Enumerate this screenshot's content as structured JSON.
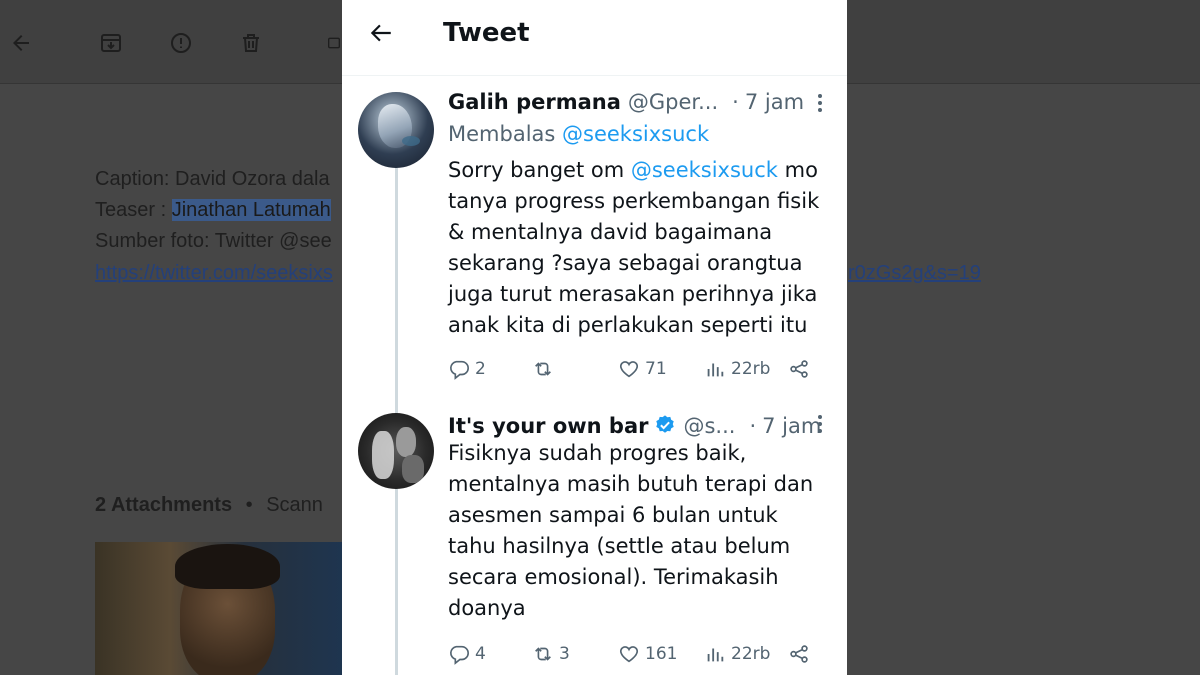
{
  "background": {
    "caption_line": "Caption: David Ozora dala",
    "teaser_label": "Teaser : ",
    "teaser_highlight": "Jinathan Latumah",
    "source_line": "Sumber foto: Twitter @see",
    "link_left": "https://twitter.com/seeksixs",
    "link_right": "r0zGs2g&s=19",
    "attachments_label": "2 Attachments",
    "attachments_sep": "•",
    "attachments_action": "Scann"
  },
  "header": {
    "title": "Tweet"
  },
  "tweets": [
    {
      "name": "Galih permana",
      "handle": "@Gper...",
      "sep": "·",
      "time": "7 jam",
      "reply_prefix": "Membalas",
      "reply_mention": "@seeksixsuck",
      "body_line1_pre": "Sorry banget om",
      "body_line1_mention": "@seeksixsuck",
      "body_line1_post": "mo",
      "body_lines": [
        "tanya progress  perkembangan fisik",
        "& mentalnya david  bagaimana",
        "sekarang ?saya sebagai orangtua",
        "juga turut merasakan perihnya jika",
        "anak kita di perlakukan seperti itu"
      ],
      "replies": "2",
      "retweets": "",
      "likes": "71",
      "views": "22rb"
    },
    {
      "name": "It's your own bar",
      "handle": "@s...",
      "sep": "·",
      "time": "7 jam",
      "body_lines": [
        "Fisiknya sudah progres baik,",
        "mentalnya masih butuh terapi dan",
        "asesmen sampai 6 bulan untuk",
        "tahu hasilnya (settle atau belum",
        "secara emosional). Terimakasih",
        "doanya"
      ],
      "replies": "4",
      "retweets": "3",
      "likes": "161",
      "views": "22rb"
    }
  ],
  "colors": {
    "accent": "#1d9bf0",
    "verified": "#1d9bf0",
    "text": "#0f1419",
    "muted": "#536471",
    "overlay": "#464646"
  }
}
